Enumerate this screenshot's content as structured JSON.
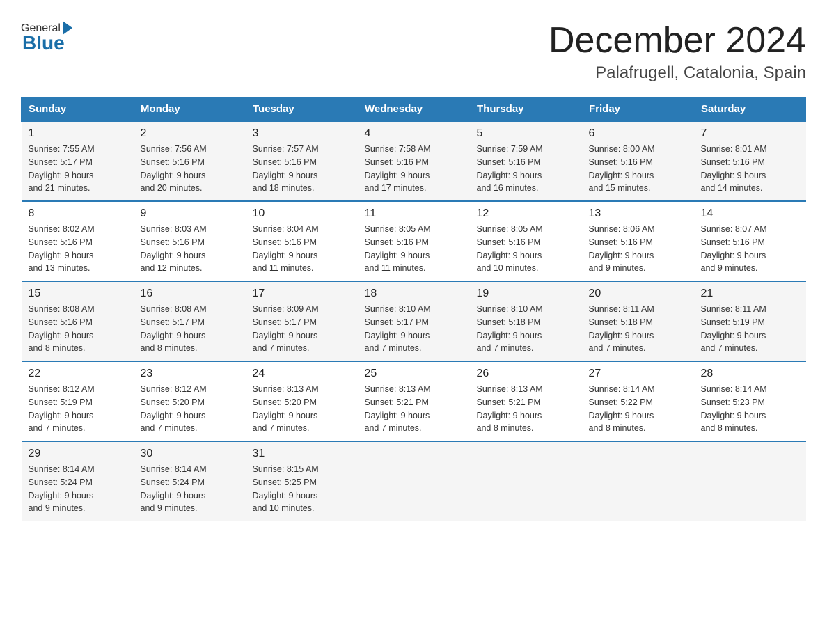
{
  "logo": {
    "general": "General",
    "blue": "Blue"
  },
  "header": {
    "title": "December 2024",
    "location": "Palafrugell, Catalonia, Spain"
  },
  "weekdays": [
    "Sunday",
    "Monday",
    "Tuesday",
    "Wednesday",
    "Thursday",
    "Friday",
    "Saturday"
  ],
  "weeks": [
    [
      {
        "day": "1",
        "sunrise": "7:55 AM",
        "sunset": "5:17 PM",
        "daylight": "9 hours and 21 minutes."
      },
      {
        "day": "2",
        "sunrise": "7:56 AM",
        "sunset": "5:16 PM",
        "daylight": "9 hours and 20 minutes."
      },
      {
        "day": "3",
        "sunrise": "7:57 AM",
        "sunset": "5:16 PM",
        "daylight": "9 hours and 18 minutes."
      },
      {
        "day": "4",
        "sunrise": "7:58 AM",
        "sunset": "5:16 PM",
        "daylight": "9 hours and 17 minutes."
      },
      {
        "day": "5",
        "sunrise": "7:59 AM",
        "sunset": "5:16 PM",
        "daylight": "9 hours and 16 minutes."
      },
      {
        "day": "6",
        "sunrise": "8:00 AM",
        "sunset": "5:16 PM",
        "daylight": "9 hours and 15 minutes."
      },
      {
        "day": "7",
        "sunrise": "8:01 AM",
        "sunset": "5:16 PM",
        "daylight": "9 hours and 14 minutes."
      }
    ],
    [
      {
        "day": "8",
        "sunrise": "8:02 AM",
        "sunset": "5:16 PM",
        "daylight": "9 hours and 13 minutes."
      },
      {
        "day": "9",
        "sunrise": "8:03 AM",
        "sunset": "5:16 PM",
        "daylight": "9 hours and 12 minutes."
      },
      {
        "day": "10",
        "sunrise": "8:04 AM",
        "sunset": "5:16 PM",
        "daylight": "9 hours and 11 minutes."
      },
      {
        "day": "11",
        "sunrise": "8:05 AM",
        "sunset": "5:16 PM",
        "daylight": "9 hours and 11 minutes."
      },
      {
        "day": "12",
        "sunrise": "8:05 AM",
        "sunset": "5:16 PM",
        "daylight": "9 hours and 10 minutes."
      },
      {
        "day": "13",
        "sunrise": "8:06 AM",
        "sunset": "5:16 PM",
        "daylight": "9 hours and 9 minutes."
      },
      {
        "day": "14",
        "sunrise": "8:07 AM",
        "sunset": "5:16 PM",
        "daylight": "9 hours and 9 minutes."
      }
    ],
    [
      {
        "day": "15",
        "sunrise": "8:08 AM",
        "sunset": "5:16 PM",
        "daylight": "9 hours and 8 minutes."
      },
      {
        "day": "16",
        "sunrise": "8:08 AM",
        "sunset": "5:17 PM",
        "daylight": "9 hours and 8 minutes."
      },
      {
        "day": "17",
        "sunrise": "8:09 AM",
        "sunset": "5:17 PM",
        "daylight": "9 hours and 7 minutes."
      },
      {
        "day": "18",
        "sunrise": "8:10 AM",
        "sunset": "5:17 PM",
        "daylight": "9 hours and 7 minutes."
      },
      {
        "day": "19",
        "sunrise": "8:10 AM",
        "sunset": "5:18 PM",
        "daylight": "9 hours and 7 minutes."
      },
      {
        "day": "20",
        "sunrise": "8:11 AM",
        "sunset": "5:18 PM",
        "daylight": "9 hours and 7 minutes."
      },
      {
        "day": "21",
        "sunrise": "8:11 AM",
        "sunset": "5:19 PM",
        "daylight": "9 hours and 7 minutes."
      }
    ],
    [
      {
        "day": "22",
        "sunrise": "8:12 AM",
        "sunset": "5:19 PM",
        "daylight": "9 hours and 7 minutes."
      },
      {
        "day": "23",
        "sunrise": "8:12 AM",
        "sunset": "5:20 PM",
        "daylight": "9 hours and 7 minutes."
      },
      {
        "day": "24",
        "sunrise": "8:13 AM",
        "sunset": "5:20 PM",
        "daylight": "9 hours and 7 minutes."
      },
      {
        "day": "25",
        "sunrise": "8:13 AM",
        "sunset": "5:21 PM",
        "daylight": "9 hours and 7 minutes."
      },
      {
        "day": "26",
        "sunrise": "8:13 AM",
        "sunset": "5:21 PM",
        "daylight": "9 hours and 8 minutes."
      },
      {
        "day": "27",
        "sunrise": "8:14 AM",
        "sunset": "5:22 PM",
        "daylight": "9 hours and 8 minutes."
      },
      {
        "day": "28",
        "sunrise": "8:14 AM",
        "sunset": "5:23 PM",
        "daylight": "9 hours and 8 minutes."
      }
    ],
    [
      {
        "day": "29",
        "sunrise": "8:14 AM",
        "sunset": "5:24 PM",
        "daylight": "9 hours and 9 minutes."
      },
      {
        "day": "30",
        "sunrise": "8:14 AM",
        "sunset": "5:24 PM",
        "daylight": "9 hours and 9 minutes."
      },
      {
        "day": "31",
        "sunrise": "8:15 AM",
        "sunset": "5:25 PM",
        "daylight": "9 hours and 10 minutes."
      },
      null,
      null,
      null,
      null
    ]
  ],
  "labels": {
    "sunrise": "Sunrise:",
    "sunset": "Sunset:",
    "daylight": "Daylight:"
  }
}
